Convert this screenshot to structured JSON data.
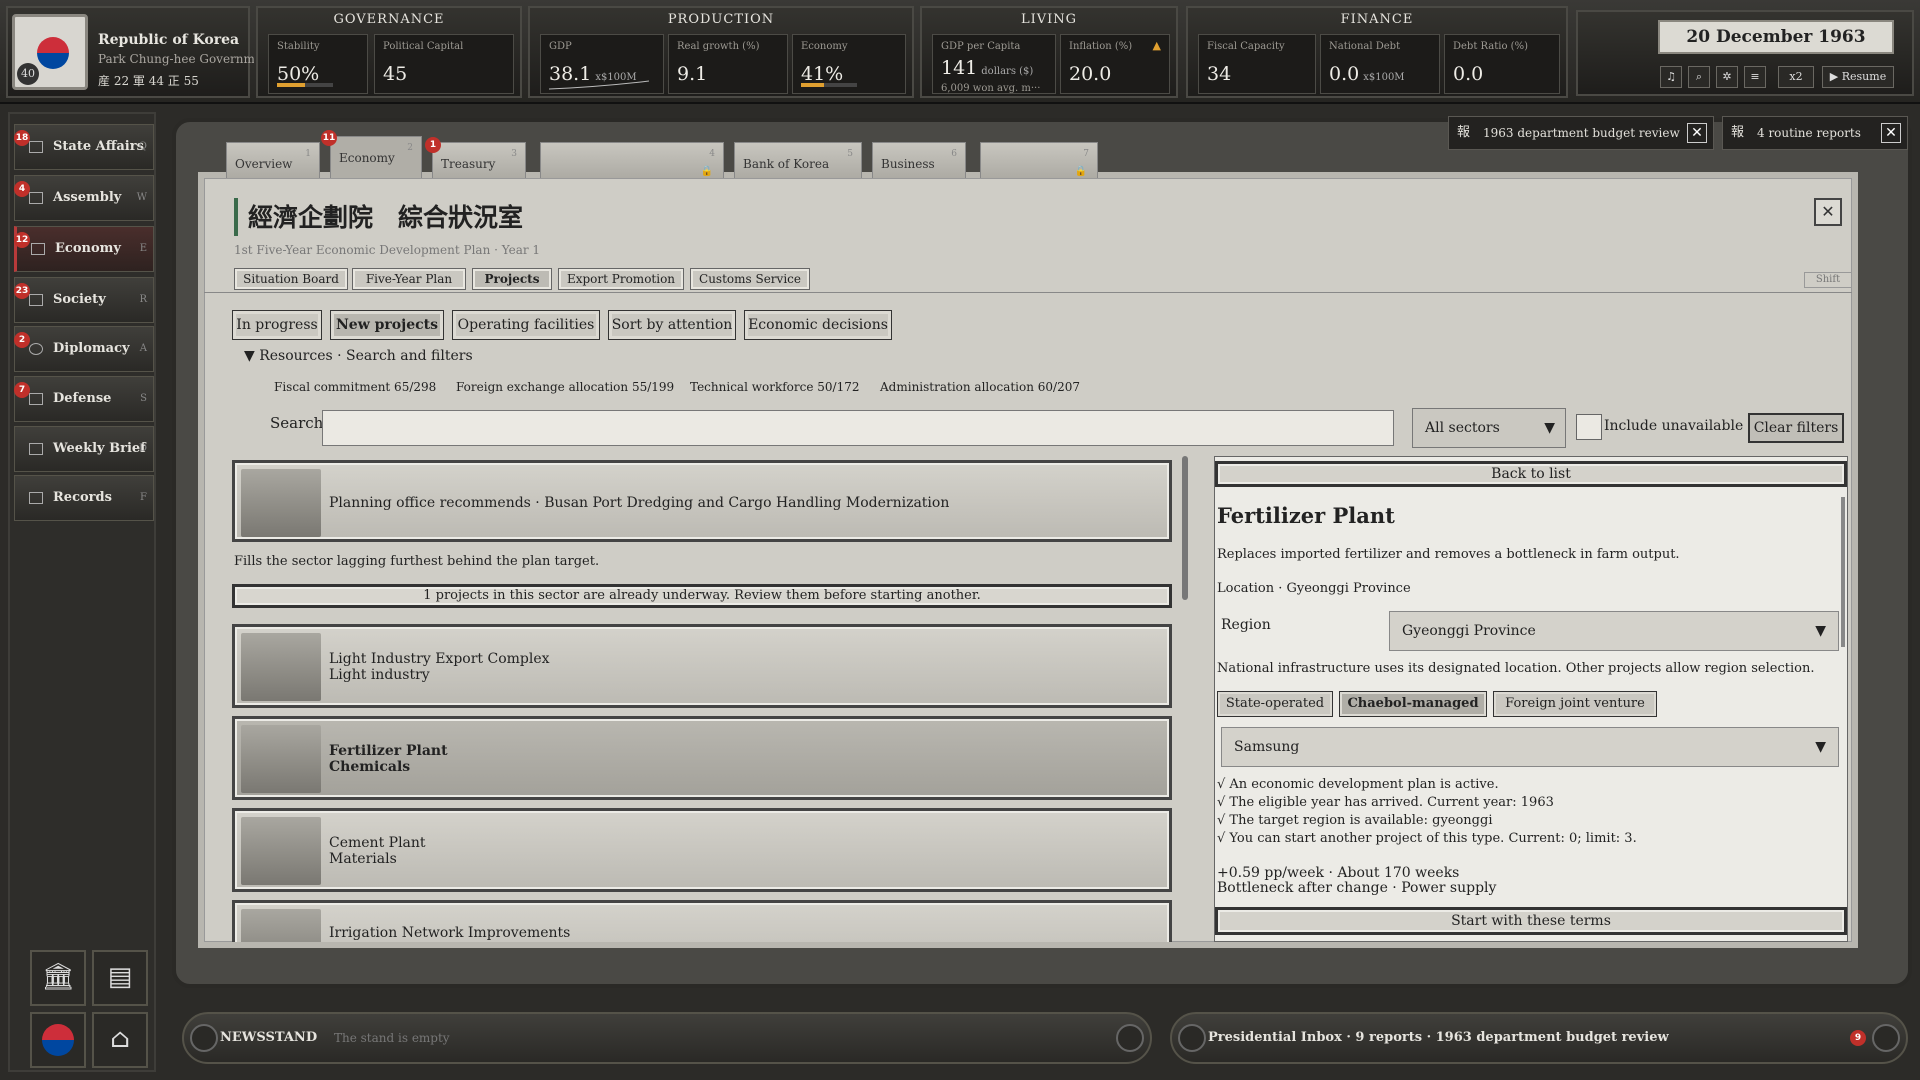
{
  "nation": {
    "name": "Republic of Korea",
    "government": "Park Chung-hee Government",
    "turn_badge": "40",
    "stats": "産 22  軍 44  正 55"
  },
  "governance": {
    "title": "GOVERNANCE",
    "stability_label": "Stability",
    "stability_value": "50%",
    "stability_fill": 0.5,
    "capital_label": "Political Capital",
    "capital_value": "45"
  },
  "production": {
    "title": "PRODUCTION",
    "gdp_label": "GDP",
    "gdp_value": "38.1",
    "gdp_unit": "x$100M",
    "growth_label": "Real growth (%)",
    "growth_value": "9.1",
    "economy_label": "Economy",
    "economy_value": "41%",
    "economy_fill": 0.41
  },
  "living": {
    "title": "LIVING",
    "gdppc_label": "GDP per Capita",
    "gdppc_value": "141",
    "gdppc_unit": "dollars ($)",
    "gdppc_sub": "6,009 won avg. m···",
    "inflation_label": "Inflation (%)",
    "inflation_value": "20.0",
    "inflation_icon": "warning-triangle"
  },
  "finance": {
    "title": "FINANCE",
    "capacity_label": "Fiscal Capacity",
    "capacity_value": "34",
    "debt_label": "National Debt",
    "debt_value": "0.0",
    "debt_unit": "x$100M",
    "ratio_label": "Debt Ratio (%)",
    "ratio_value": "0.0"
  },
  "date": {
    "value": "20 December 1963",
    "speed": "x2",
    "resume": "Resume"
  },
  "sidebar": {
    "items": [
      {
        "label": "State Affairs",
        "key": "Q",
        "badge": "18"
      },
      {
        "label": "Assembly",
        "key": "W",
        "badge": "4"
      },
      {
        "label": "Economy",
        "key": "E",
        "badge": "12"
      },
      {
        "label": "Society",
        "key": "R",
        "badge": "23"
      },
      {
        "label": "Diplomacy",
        "key": "A",
        "badge": "2"
      },
      {
        "label": "Defense",
        "key": "S",
        "badge": "7"
      },
      {
        "label": "Weekly Brief",
        "key": "D",
        "badge": ""
      },
      {
        "label": "Records",
        "key": "F",
        "badge": ""
      }
    ]
  },
  "tabs": [
    {
      "label": "Overview",
      "num": "1",
      "badge": ""
    },
    {
      "label": "Economy",
      "num": "2",
      "badge": "11"
    },
    {
      "label": "Treasury",
      "num": "3",
      "badge": "1"
    },
    {
      "label": "",
      "num": "4",
      "badge": ""
    },
    {
      "label": "Bank of Korea",
      "num": "5",
      "badge": ""
    },
    {
      "label": "Business",
      "num": "6",
      "badge": ""
    },
    {
      "label": "",
      "num": "7",
      "badge": ""
    }
  ],
  "notifications": [
    {
      "icon": "報",
      "text": "1963 department budget review"
    },
    {
      "icon": "報",
      "text": "4 routine reports"
    }
  ],
  "header": {
    "title": "經濟企劃院　綜合狀況室",
    "subtitle": "1st Five-Year Economic Development Plan · Year 1",
    "shift": "Shift"
  },
  "subtabs": [
    "Situation Board",
    "Five-Year Plan",
    "Projects",
    "Export Promotion",
    "Customs Service"
  ],
  "filters": {
    "buttons": [
      "In progress",
      "New projects",
      "Operating facilities",
      "Sort by attention",
      "Economic decisions"
    ],
    "section_title": "▼  Resources · Search and filters",
    "resources": [
      "Fiscal commitment 65/298",
      "Foreign exchange allocation 55/199",
      "Technical workforce 50/172",
      "Administration allocation 60/207"
    ],
    "search_label": "Search",
    "search_value": "",
    "sector_select": "All sectors",
    "include_label": "Include unavailable",
    "clear_label": "Clear filters"
  },
  "list": {
    "recommend": "Planning office recommends · Busan Port Dredging and Cargo Handling Modernization",
    "note": "Fills the sector lagging furthest behind the plan target.",
    "warning": "1 projects in this sector are already underway. Review them before starting another.",
    "cards": [
      {
        "name": "Light Industry Export Complex",
        "sector": "Light industry"
      },
      {
        "name": "Fertilizer Plant",
        "sector": "Chemicals"
      },
      {
        "name": "Cement Plant",
        "sector": "Materials"
      },
      {
        "name": "Irrigation Network Improvements",
        "sector": ""
      }
    ]
  },
  "detail": {
    "back": "Back to list",
    "title": "Fertilizer Plant",
    "desc": "Replaces imported fertilizer and removes a bottleneck in farm output.",
    "location": "Location · Gyeonggi Province",
    "region_label": "Region",
    "region_value": "Gyeonggi Province",
    "infra_note": "National infrastructure uses its designated location. Other projects allow region selection.",
    "ownership": [
      "State-operated",
      "Chaebol-managed",
      "Foreign joint venture"
    ],
    "company": "Samsung",
    "checks": [
      "√ An economic development plan is active.",
      "√ The eligible year has arrived. Current year: 1963",
      "√ The target region is available: gyeonggi",
      "√ You can start another project of this type. Current: 0; limit: 3."
    ],
    "effect1": "+0.59 pp/week · About 170 weeks",
    "effect2": "Bottleneck after change · Power supply",
    "start": "Start with these terms"
  },
  "footer": {
    "news_label": "NEWSSTAND",
    "news_value": "The stand is empty",
    "inbox_label": "Presidential Inbox · 9 reports · 1963 department budget review",
    "inbox_badge": "9"
  }
}
